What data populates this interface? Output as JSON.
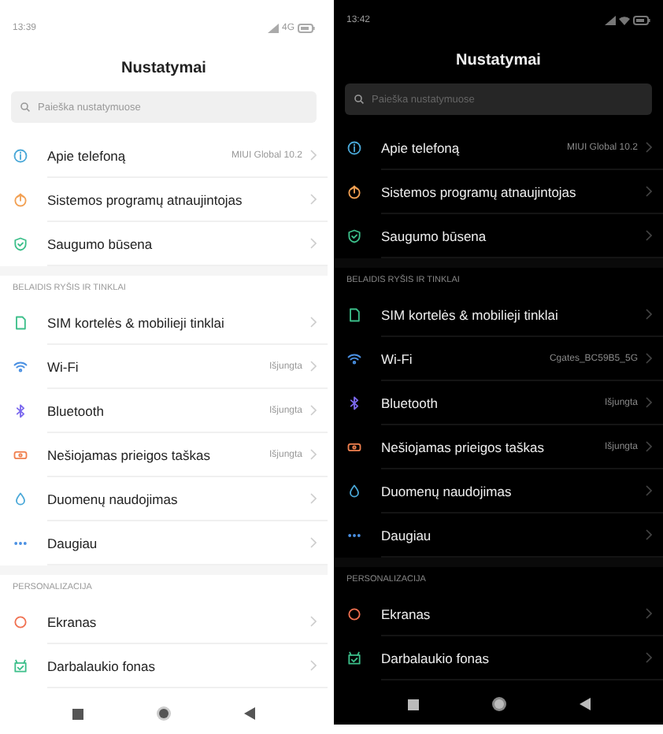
{
  "phones": [
    {
      "dark": false,
      "status_bar": {
        "time": "13:39",
        "network": "4G",
        "wifi": false
      },
      "title": "Nustatymai",
      "search": {
        "placeholder": "Paieška nustatymuose"
      },
      "sections": [
        {
          "items": [
            {
              "kind": "info",
              "color": "#4aa8d8",
              "label": "Apie telefoną",
              "value": "MIUI Global 10.2"
            },
            {
              "kind": "update",
              "color": "#f2a053",
              "label": "Sistemos programų atnaujintojas"
            },
            {
              "kind": "shield",
              "color": "#3cbf8a",
              "label": "Saugumo būsena"
            }
          ]
        },
        {
          "header": "BELAIDIS RYŠIS IR TINKLAI",
          "items": [
            {
              "kind": "sim",
              "color": "#3cbf8a",
              "label": "SIM kortelės & mobilieji tinklai"
            },
            {
              "kind": "wifi",
              "color": "#4a90e2",
              "label": "Wi-Fi",
              "value": "Išjungta"
            },
            {
              "kind": "bluetooth",
              "color": "#7b68ee",
              "label": "Bluetooth",
              "value": "Išjungta"
            },
            {
              "kind": "hotspot",
              "color": "#f0804f",
              "label": "Nešiojamas prieigos taškas",
              "value": "Išjungta"
            },
            {
              "kind": "data",
              "color": "#4aa8d8",
              "label": "Duomenų naudojimas"
            },
            {
              "kind": "more",
              "color": "#4a90e2",
              "label": "Daugiau"
            }
          ]
        },
        {
          "header": "PERSONALIZACIJA",
          "items": [
            {
              "kind": "display",
              "color": "#f07050",
              "label": "Ekranas"
            },
            {
              "kind": "wallpaper",
              "color": "#3cbf8a",
              "label": "Darbalaukio fonas"
            }
          ]
        }
      ]
    },
    {
      "dark": true,
      "status_bar": {
        "time": "13:42",
        "wifi": true
      },
      "title": "Nustatymai",
      "search": {
        "placeholder": "Paieška nustatymuose"
      },
      "sections": [
        {
          "items": [
            {
              "kind": "info",
              "color": "#4aa8d8",
              "label": "Apie telefoną",
              "value": "MIUI Global 10.2"
            },
            {
              "kind": "update",
              "color": "#f2a053",
              "label": "Sistemos programų atnaujintojas"
            },
            {
              "kind": "shield",
              "color": "#3cbf8a",
              "label": "Saugumo būsena"
            }
          ]
        },
        {
          "header": "BELAIDIS RYŠIS IR TINKLAI",
          "items": [
            {
              "kind": "sim",
              "color": "#3cbf8a",
              "label": "SIM kortelės & mobilieji tinklai"
            },
            {
              "kind": "wifi",
              "color": "#4a90e2",
              "label": "Wi-Fi",
              "value": "Cgates_BC59B5_5G"
            },
            {
              "kind": "bluetooth",
              "color": "#7b68ee",
              "label": "Bluetooth",
              "value": "Išjungta"
            },
            {
              "kind": "hotspot",
              "color": "#f0804f",
              "label": "Nešiojamas prieigos taškas",
              "value": "Išjungta"
            },
            {
              "kind": "data",
              "color": "#4aa8d8",
              "label": "Duomenų naudojimas"
            },
            {
              "kind": "more",
              "color": "#4a90e2",
              "label": "Daugiau"
            }
          ]
        },
        {
          "header": "PERSONALIZACIJA",
          "items": [
            {
              "kind": "display",
              "color": "#f07050",
              "label": "Ekranas"
            },
            {
              "kind": "wallpaper",
              "color": "#3cbf8a",
              "label": "Darbalaukio fonas"
            }
          ]
        }
      ]
    }
  ]
}
